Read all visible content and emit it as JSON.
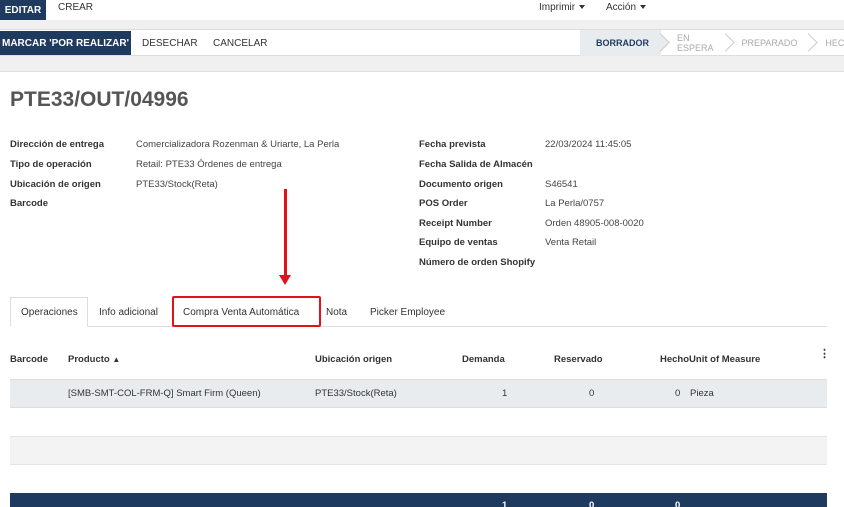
{
  "toolbar": {
    "edit_label": "EDITAR",
    "create_label": "CREAR",
    "print_label": "Imprimir",
    "action_label": "Acción"
  },
  "actions": {
    "mark_todo_label": "MARCAR 'POR REALIZAR'",
    "discard_label": "DESECHAR",
    "cancel_label": "CANCELAR"
  },
  "statusbar": {
    "stages": [
      "BORRADOR",
      "EN ESPERA",
      "PREPARADO",
      "HECHO"
    ],
    "active": "BORRADOR"
  },
  "record": {
    "title": "PTE33/OUT/04996"
  },
  "left_fields": [
    {
      "label": "Dirección de entrega",
      "value": "Comercializadora Rozenman & Uriarte, La Perla"
    },
    {
      "label": "Tipo de operación",
      "value": "Retail: PTE33 Órdenes de entrega"
    },
    {
      "label": "Ubicación de origen",
      "value": "PTE33/Stock(Reta)"
    },
    {
      "label": "Barcode",
      "value": ""
    }
  ],
  "right_fields": [
    {
      "label": "Fecha prevista",
      "value": "22/03/2024 11:45:05"
    },
    {
      "label": "Fecha Salida de Almacén",
      "value": ""
    },
    {
      "label": "Documento origen",
      "value": "S46541"
    },
    {
      "label": "POS Order",
      "value": "La Perla/0757"
    },
    {
      "label": "Receipt Number",
      "value": "Orden 48905-008-0020"
    },
    {
      "label": "Equipo de ventas",
      "value": "Venta Retail"
    },
    {
      "label": "Número de orden Shopify",
      "value": ""
    }
  ],
  "tabs": [
    "Operaciones",
    "Info adicional",
    "Compra Venta Automática",
    "Nota",
    "Picker Employee"
  ],
  "table": {
    "headers": {
      "barcode": "Barcode",
      "product": "Producto",
      "origin": "Ubicación origen",
      "demand": "Demanda",
      "reserved": "Reservado",
      "done_uom": "HechoUnit of Measure"
    },
    "rows": [
      {
        "barcode": "",
        "product": "[SMB-SMT-COL-FRM-Q] Smart Firm (Queen)",
        "origin": "PTE33/Stock(Reta)",
        "demand": "1",
        "reserved": "0",
        "done": "0",
        "uom": "Pieza"
      }
    ],
    "totals": {
      "demand": "1",
      "reserved": "0",
      "done": "0"
    }
  },
  "colors": {
    "primary": "#1f3a5f",
    "annotation": "#e0121a"
  }
}
